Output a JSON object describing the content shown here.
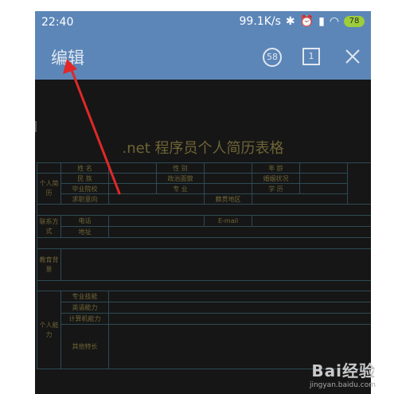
{
  "status_bar": {
    "time": "22:40",
    "network_speed": "99.1K/s",
    "battery": "78"
  },
  "toolbar": {
    "title": "编辑",
    "page_count_icon_label": "58",
    "tab_count_icon_label": "1"
  },
  "document": {
    "title": ".net 程序员个人简历表格",
    "sections": {
      "personal_history": "个人简历",
      "contact": "联系方式",
      "education": "教育背景",
      "ability": "个人能力"
    },
    "fields": {
      "name": "姓 名",
      "gender": "性 别",
      "age": "年 龄",
      "ethnicity": "民 族",
      "political": "政治面貌",
      "marital": "婚姻状况",
      "school": "毕业院校",
      "major": "专 业",
      "degree": "学 历",
      "job_intention": "求职意向",
      "hometown": "籍贯地区",
      "phone": "电话",
      "email": "E-mail",
      "address": "地址",
      "skills": "专业技能",
      "language": "英语能力",
      "computer": "计算机能力",
      "other": "其他特长"
    }
  },
  "watermark": {
    "logo": "Bai经验",
    "url": "jingyan.baidu.com"
  }
}
